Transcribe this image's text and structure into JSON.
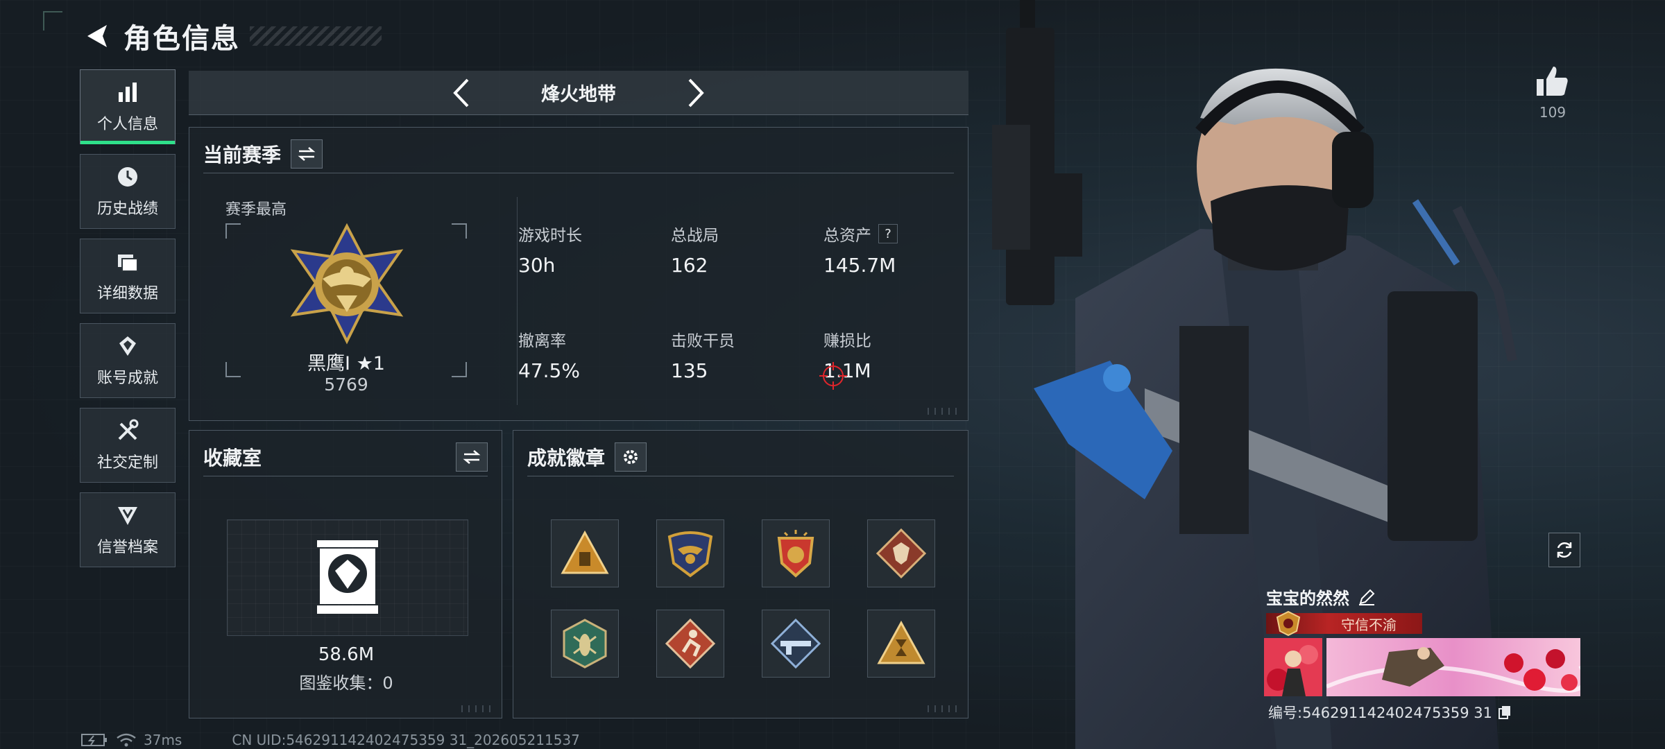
{
  "header": {
    "title": "角色信息"
  },
  "sidebar": {
    "items": [
      {
        "label": "个人信息",
        "icon": "bar-chart-icon",
        "active": true
      },
      {
        "label": "历史战绩",
        "icon": "history-clock-icon",
        "active": false
      },
      {
        "label": "详细数据",
        "icon": "folder-data-icon",
        "active": false
      },
      {
        "label": "账号成就",
        "icon": "achievement-icon",
        "active": false
      },
      {
        "label": "社交定制",
        "icon": "wrench-tools-icon",
        "active": false
      },
      {
        "label": "信誉档案",
        "icon": "credit-shield-icon",
        "active": false
      }
    ]
  },
  "mode": {
    "name": "烽火地带"
  },
  "season": {
    "title": "当前赛季",
    "highest_label": "赛季最高",
    "rank_name": "黑鹰I ★1",
    "rank_score": "5769",
    "stats": [
      {
        "label": "游戏时长",
        "value": "30h"
      },
      {
        "label": "总战局",
        "value": "162"
      },
      {
        "label": "总资产",
        "value": "145.7M",
        "help": "?"
      },
      {
        "label": "撤离率",
        "value": "47.5%"
      },
      {
        "label": "击败干员",
        "value": "135"
      },
      {
        "label": "赚损比",
        "value": "1.1M"
      }
    ]
  },
  "collection": {
    "title": "收藏室",
    "value": "58.6M",
    "count_text": "图鉴收集：0"
  },
  "badges": {
    "title": "成就徽章",
    "items": [
      {
        "name": "triangle-gold-badge",
        "color": "#c98a2a"
      },
      {
        "name": "eagle-shield-badge",
        "color": "#d2a03a"
      },
      {
        "name": "stars-shield-badge",
        "color": "#c9382e"
      },
      {
        "name": "wolf-diamond-badge",
        "color": "#b5503a"
      },
      {
        "name": "hex-insect-badge",
        "color": "#2f6b58"
      },
      {
        "name": "runner-diamond-badge",
        "color": "#b3452f"
      },
      {
        "name": "rifle-diamond-badge",
        "color": "#3c6a9a"
      },
      {
        "name": "hourglass-triangle-badge",
        "color": "#c08a2f"
      }
    ]
  },
  "status": {
    "ping": "37ms",
    "uid": "CN UID:546291142402475359 31_202605211537"
  },
  "profile": {
    "likes": "109",
    "player_name": "宝宝的然然",
    "title_tag": "守信不渝",
    "player_id": "编号:546291142402475359 31"
  },
  "colors": {
    "accent_green": "#2fe08a",
    "title_red": "#b82424"
  }
}
